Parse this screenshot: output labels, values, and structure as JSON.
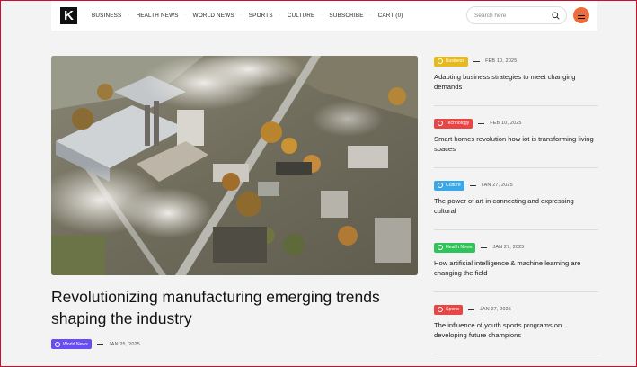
{
  "header": {
    "logo_text": "K",
    "nav": [
      "BUSINESS",
      "HEALTH NEWS",
      "WORLD NEWS",
      "SPORTS",
      "CULTURE",
      "SUBSCRIBE",
      "CART (0)"
    ],
    "search_placeholder": "Search here",
    "icons": {
      "search": "search-icon",
      "menu": "hamburger-icon"
    },
    "menu_color": "#ef6b3a"
  },
  "hero": {
    "title": "Revolutionizing manufacturing emerging trends shaping the industry",
    "category": "World News",
    "category_color": "#6a4cf5",
    "date": "JAN 25, 2025"
  },
  "sidebar": [
    {
      "category": "Business",
      "color": "#e7b91d",
      "date": "FEB 10, 2025",
      "title": "Adapting business strategies to meet changing demands"
    },
    {
      "category": "Technology",
      "color": "#e84545",
      "date": "FEB 10, 2025",
      "title": "Smart homes revolution how iot is transforming living spaces"
    },
    {
      "category": "Culture",
      "color": "#3aa8e8",
      "date": "JAN 27, 2025",
      "title": "The power of art in connecting and expressing cultural"
    },
    {
      "category": "Health News",
      "color": "#2fc45a",
      "date": "JAN 27, 2025",
      "title": "How artificial intelligence & machine learning are changing the field"
    },
    {
      "category": "Sports",
      "color": "#e84545",
      "date": "JAN 27, 2025",
      "title": "The influence of youth sports programs on developing future champions"
    }
  ]
}
